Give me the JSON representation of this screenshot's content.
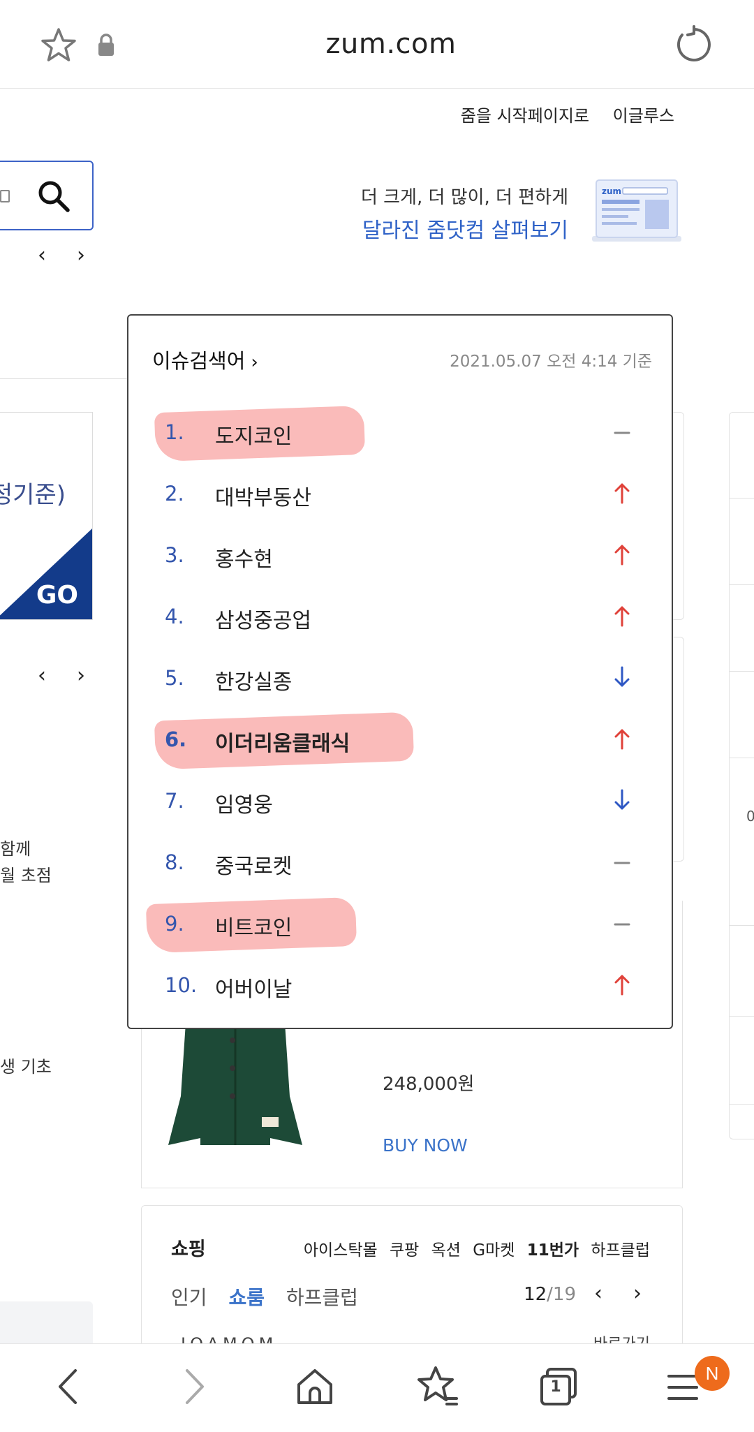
{
  "browser": {
    "url": "zum.com",
    "tab_count": "1",
    "menu_badge": "N"
  },
  "header": {
    "links": [
      "줌을 시작페이지로",
      "이글루스"
    ],
    "promo_line1": "더 크게, 더 많이, 더 편하게",
    "promo_line2": "달라진 줌닷컴 살펴보기",
    "promo_logo": "zum"
  },
  "background": {
    "banner_text": "정기준)",
    "banner_go": "GO",
    "left_text_1a": "함께",
    "left_text_1b": "월 초점",
    "left_text_2": "생 기초",
    "right_number": "0"
  },
  "product": {
    "price": "248,000원",
    "buy_label": "BUY NOW"
  },
  "shopping": {
    "title": "쇼핑",
    "links": [
      "아이스탁몰",
      "쿠팡",
      "옥션",
      "G마켓",
      "11번가",
      "하프클럽"
    ],
    "tabs": [
      "인기",
      "쇼룸",
      "하프클럽"
    ],
    "active_tab": "쇼룸",
    "page_current": "12",
    "page_total": "/19",
    "cut_text": "JOAMOM",
    "cut_text_right": "바로가기"
  },
  "issue": {
    "title": "이슈검색어",
    "timestamp": "2021.05.07 오전 4:14 기준",
    "items": [
      {
        "rank": "1.",
        "keyword": "도지코인",
        "trend": "same",
        "highlight": true
      },
      {
        "rank": "2.",
        "keyword": "대박부동산",
        "trend": "up",
        "highlight": false
      },
      {
        "rank": "3.",
        "keyword": "홍수현",
        "trend": "up",
        "highlight": false
      },
      {
        "rank": "4.",
        "keyword": "삼성중공업",
        "trend": "up",
        "highlight": false
      },
      {
        "rank": "5.",
        "keyword": "한강실종",
        "trend": "down",
        "highlight": false
      },
      {
        "rank": "6.",
        "keyword": "이더리움클래식",
        "trend": "up",
        "highlight": true
      },
      {
        "rank": "7.",
        "keyword": "임영웅",
        "trend": "down",
        "highlight": false
      },
      {
        "rank": "8.",
        "keyword": "중국로켓",
        "trend": "same",
        "highlight": false
      },
      {
        "rank": "9.",
        "keyword": "비트코인",
        "trend": "same",
        "highlight": true
      },
      {
        "rank": "10.",
        "keyword": "어버이날",
        "trend": "up",
        "highlight": false
      }
    ]
  },
  "colors": {
    "rank_blue": "#3456ad",
    "trend_up": "#e0423a",
    "trend_down": "#2f58c4",
    "trend_same": "#888888",
    "highlight": "#f9b4b2",
    "accent_blue": "#2f62c7"
  },
  "icons": {
    "star": "star-icon",
    "lock": "lock-icon",
    "reload": "reload-icon",
    "search": "search-icon",
    "back": "back-arrow-icon",
    "forward": "forward-arrow-icon",
    "home": "home-icon",
    "bookmarks": "bookmarks-icon",
    "tabs": "tabs-icon",
    "menu": "menu-icon"
  }
}
